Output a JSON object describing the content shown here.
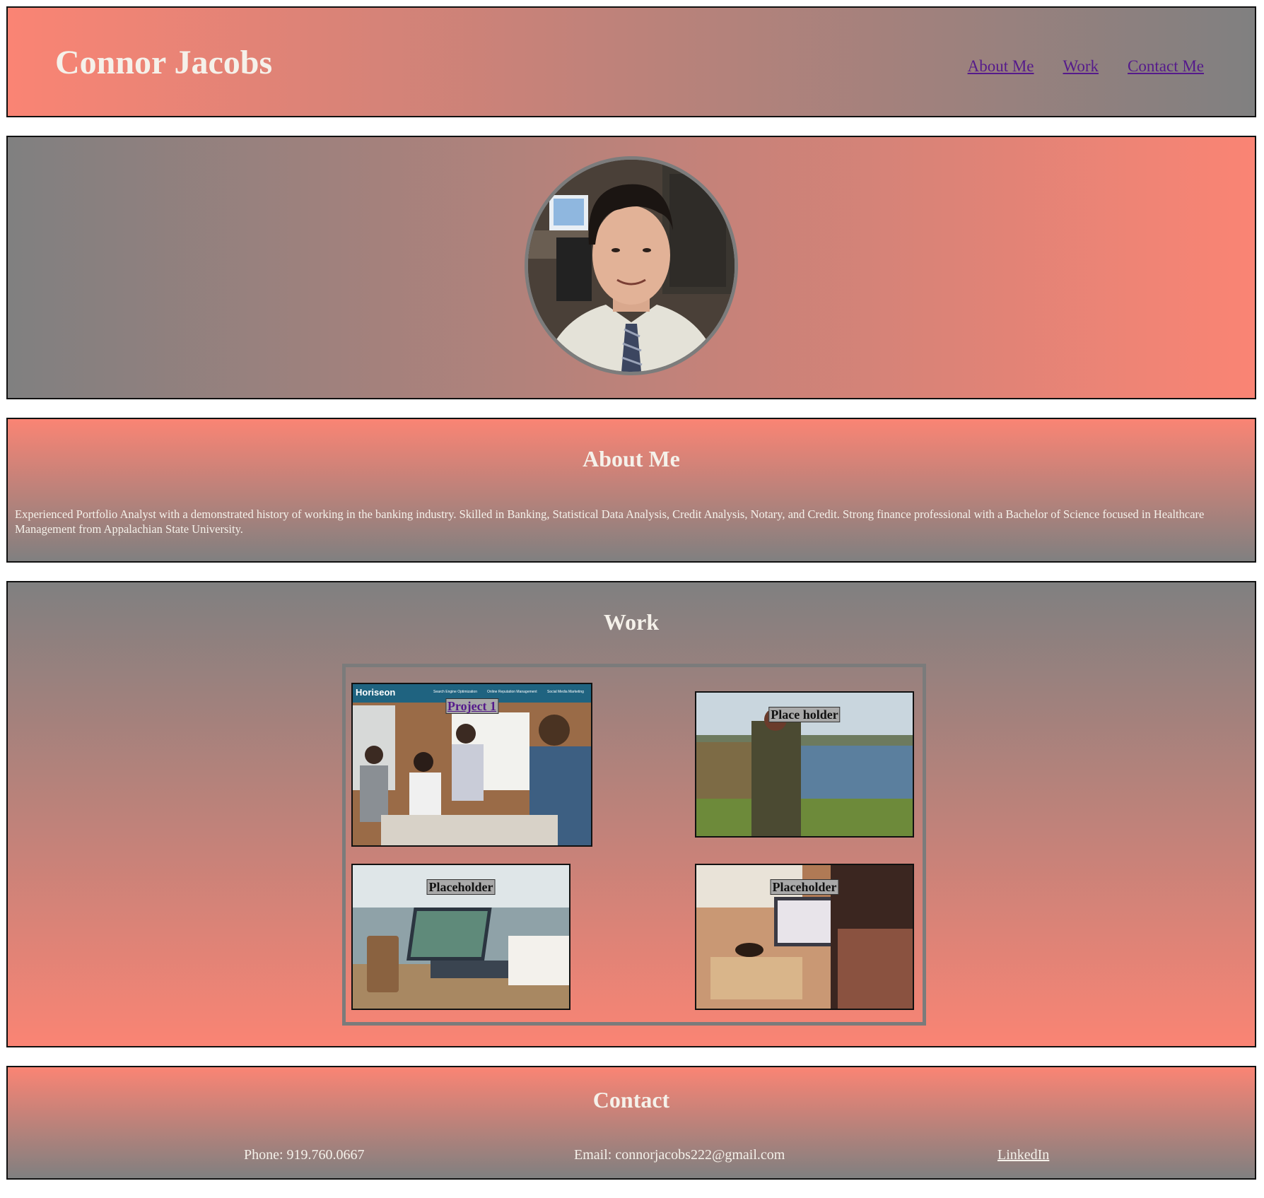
{
  "header": {
    "title": "Connor Jacobs",
    "nav": [
      {
        "label": "About Me"
      },
      {
        "label": "Work"
      },
      {
        "label": "Contact Me"
      }
    ]
  },
  "hero": {
    "avatar": "profile-photo"
  },
  "about": {
    "heading": "About Me",
    "text": "Experienced Portfolio Analyst with a demonstrated history of working in the banking industry. Skilled in Banking, Statistical Data Analysis, Credit Analysis, Notary, and Credit. Strong finance professional with a Bachelor of Science focused in Healthcare Management from Appalachian State University."
  },
  "work": {
    "heading": "Work",
    "projects": [
      {
        "label": "Project 1",
        "screenshot_brand": "Horiseon",
        "screenshot_nav": [
          "Search Engine Optimization",
          "Online Reputation Management",
          "Social Media Marketing"
        ]
      },
      {
        "label": "Place holder"
      },
      {
        "label": "Placeholder"
      },
      {
        "label": "Placeholder"
      }
    ]
  },
  "contact": {
    "heading": "Contact",
    "phone": "Phone: 919.760.0667",
    "email": "Email: connorjacobs222@gmail.com",
    "linkedin": "LinkedIn"
  },
  "colors": {
    "salmon": "#fa8474",
    "gray": "#808080",
    "link": "#551a8b"
  }
}
